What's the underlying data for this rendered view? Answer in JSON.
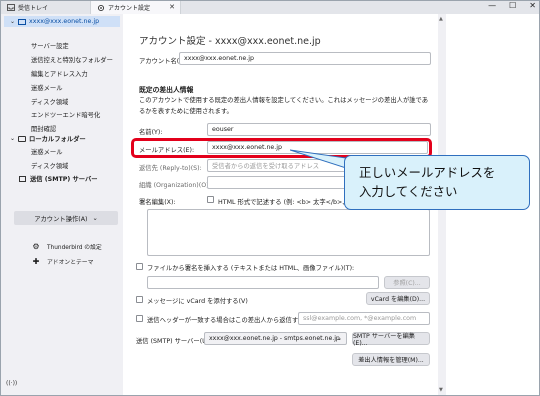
{
  "tabs": [
    {
      "label": "受信トレイ",
      "icon": "inbox-icon"
    },
    {
      "label": "アカウント設定",
      "icon": "settings-gear-icon"
    }
  ],
  "window_controls": {
    "minimize": "—",
    "maximize": "☐",
    "close": "✕"
  },
  "sidebar": {
    "account": "xxxx@xxx.eonet.ne.jp",
    "account_items": [
      "サーバー設定",
      "送信控えと特別なフォルダー",
      "編集とアドレス入力",
      "迷惑メール",
      "ディスク領域",
      "エンドツーエンド暗号化",
      "開封確認"
    ],
    "local_folders": "ローカルフォルダー",
    "local_items": [
      "迷惑メール",
      "ディスク領域"
    ],
    "smtp": "送信 (SMTP) サーバー",
    "account_actions": "アカウント操作(A)",
    "footer_items": [
      {
        "label": "Thunderbird の設定",
        "icon": "gear-icon"
      },
      {
        "label": "アドオンとテーマ",
        "icon": "puzzle-icon"
      }
    ]
  },
  "main": {
    "title": "アカウント設定 - xxxx@xxx.eonet.ne.jp",
    "account_name_label": "アカウント名(N):",
    "account_name_value": "xxxx@xxx.eonet.ne.jp",
    "section_title": "既定の差出人情報",
    "section_desc": "このアカウントで使用する既定の差出人情報を設定してください。これはメッセージの差出人が誰であるかを表すために使用されます。",
    "name_label": "名前(Y):",
    "name_value": "eouser",
    "email_label": "メールアドレス(E):",
    "email_value": "xxxx@xxx.eonet.ne.jp",
    "reply_to_label": "返信先 (Reply-to)(S):",
    "reply_to_placeholder": "受信者からの返信を受け取るアドレス",
    "org_label": "組織 (Organization)(O):",
    "signature_label": "署名編集(X):",
    "html_sig_label": "HTML 形式で記述する (例: <b> 太字</b>、さ",
    "attach_sig_label": "ファイルから署名を挿入する (テキストまたは HTML、画像ファイル)(T):",
    "browse_button": "参照(C)...",
    "vcard_label": "メッセージに vCard を添付する(V)",
    "vcard_button": "vCard を編集(D)...",
    "reply_from_label": "送信ヘッダーが一致する場合はこの差出人から返信する(P):",
    "reply_from_placeholder": "ssl@example.com, *@example.com",
    "smtp_label": "送信 (SMTP) サーバー(U):",
    "smtp_value": "xxxx@xxx.eonet.ne.jp - smtps.eonet.ne.jp",
    "smtp_edit_button": "SMTP サーバーを編集(E)...",
    "manage_identities_button": "差出人情報を管理(M)..."
  },
  "callout": {
    "line1": "正しいメールアドレスを",
    "line2": "入力してください"
  },
  "status_icon": "activity-icon",
  "colors": {
    "highlight": "#e3001b",
    "callout_bg": "#d9f1fb",
    "callout_border": "#2f6fbe",
    "account_selected": "#cfe0f7"
  }
}
